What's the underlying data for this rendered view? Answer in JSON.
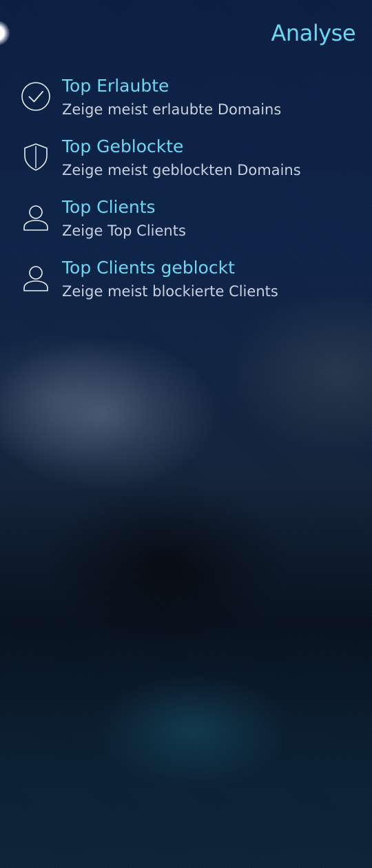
{
  "header": {
    "title": "Analyse"
  },
  "menu": {
    "items": [
      {
        "title": "Top Erlaubte",
        "description": "Zeige meist erlaubte Domains",
        "icon": "check-circle-icon"
      },
      {
        "title": "Top Geblockte",
        "description": "Zeige meist geblockten Domains",
        "icon": "shield-icon"
      },
      {
        "title": "Top Clients",
        "description": "Zeige Top Clients",
        "icon": "person-icon"
      },
      {
        "title": "Top Clients geblockt",
        "description": "Zeige meist blockierte Clients",
        "icon": "person-icon"
      }
    ]
  },
  "colors": {
    "accent": "#6fd6f2",
    "secondary_text": "#c8d0dc",
    "icon_stroke": "#e8eef5",
    "background": "#0a1e42"
  }
}
